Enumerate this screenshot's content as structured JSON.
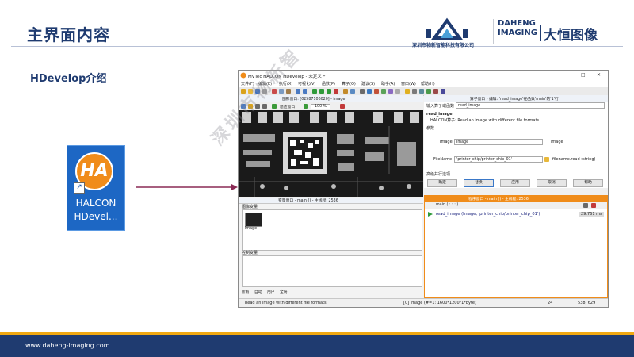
{
  "slide": {
    "title": "主界面内容",
    "subtitle": "HDevelop介绍",
    "footer_url": "www.daheng-imaging.com"
  },
  "logos": {
    "left_company": "深圳市物新智能科技有限公司",
    "right_en_line1": "DAHENG",
    "right_en_line2": "IMAGING",
    "right_cn": "大恒图像"
  },
  "desktop_icon": {
    "badge_text": "HA",
    "label_line1": "HALCON",
    "label_line2": "HDevel..."
  },
  "watermark": "深圳市物新智",
  "window": {
    "title": "MVTec HALCON HDevelop - 未定义 *",
    "menu": [
      "文件(F)",
      "编辑(E)",
      "执行(X)",
      "可视化(V)",
      "函数(P)",
      "算子(O)",
      "建议(S)",
      "助手(A)",
      "窗口(W)",
      "帮助(H)"
    ],
    "graphics_header": "图形窗口: [02587106020] - image",
    "graphics_zoom_label": "适应窗口",
    "graphics_zoom_value": "100 %",
    "operator_header": "算子窗口 - 编辑: 'read_image'在函数'main'的'1'行",
    "operator_search_label": "输入算子或函数",
    "operator_search_value": "read_image",
    "op_name": "read_image",
    "op_desc": "HALCON算子: Read an image with different file formats.",
    "params_label": "参数",
    "param_image_label": "Image",
    "param_image_value": "Image",
    "param_image_type": "image",
    "param_filename_label": "FileName",
    "param_filename_value": "'printer_chip/printer_chip_01'",
    "param_filename_type": "filename.read (string)",
    "advanced_label": "高级并行选项",
    "buttons": [
      "确定",
      "替换",
      "应用",
      "取消",
      "帮助"
    ],
    "program_header": "程序窗口 - main () - 主线程: 2536",
    "program_func": "main ( : : : )",
    "program_code": "read_image (Image, 'printer_chip/printer_chip_01')",
    "program_time": "29.761 ms",
    "variables_header": "变量窗口 - main () - 主线程: 2536",
    "iconic_vars_label": "图像变量",
    "var_thumb_label": "Image",
    "control_vars_label": "控制变量",
    "var_tabs": [
      "所有",
      "自动",
      "用户",
      "全局"
    ],
    "status_text": "Read an image with different file formats.",
    "status_image_info": "[0] Image (#=1: 1600*1200*1*byte)",
    "status_gray": "24",
    "status_coords": "538, 629"
  }
}
